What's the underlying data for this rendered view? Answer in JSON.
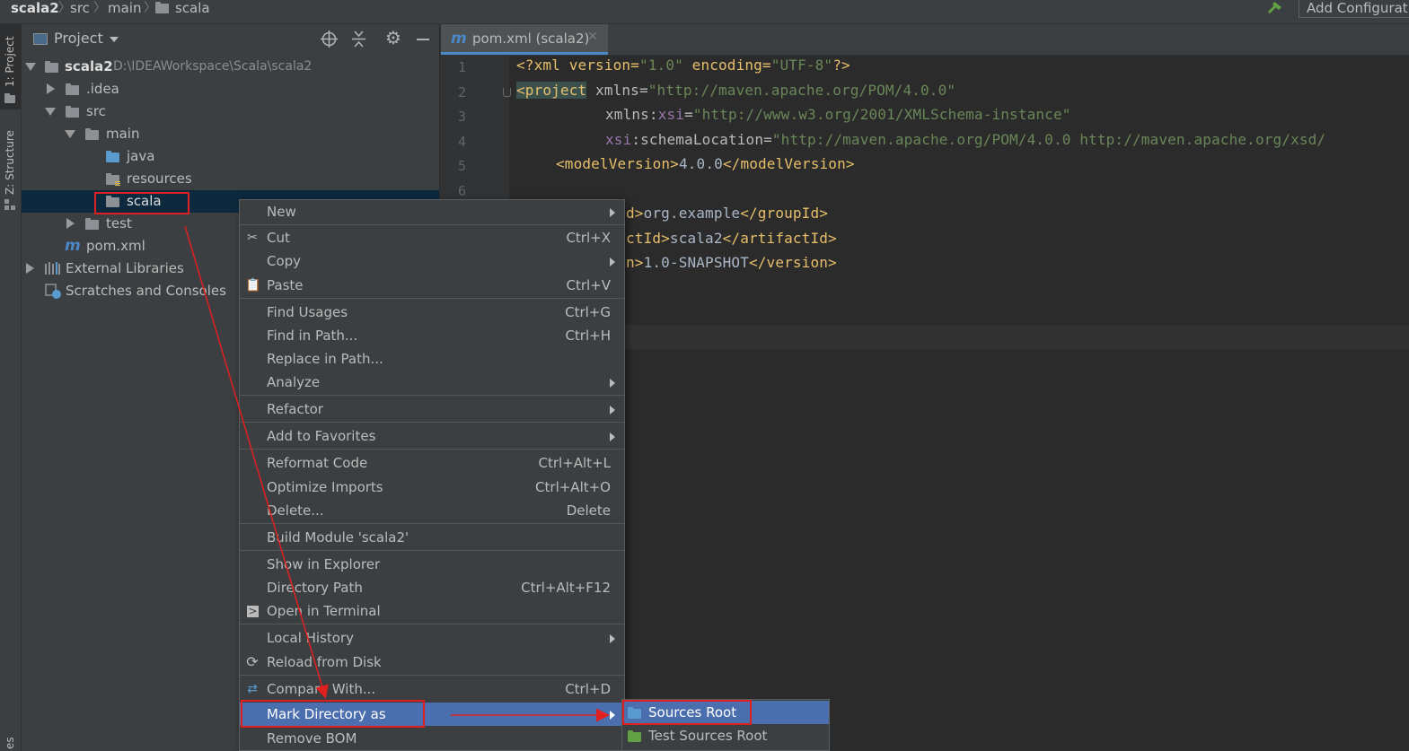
{
  "navbar": {
    "crumbs": [
      "scala2",
      "src",
      "main",
      "scala"
    ],
    "run_config_label": "Add Configurat"
  },
  "leftstrip": {
    "project_tool": "1: Project",
    "structure_tool": "Z: Structure",
    "bottom_tool": "es"
  },
  "project_panel": {
    "title": "Project",
    "tree": [
      {
        "label": "scala2",
        "path": "D:\\IDEAWorkspace\\Scala\\scala2"
      },
      {
        "label": ".idea"
      },
      {
        "label": "src"
      },
      {
        "label": "main"
      },
      {
        "label": "java"
      },
      {
        "label": "resources"
      },
      {
        "label": "scala"
      },
      {
        "label": "test"
      },
      {
        "label": "pom.xml"
      },
      {
        "label": "External Libraries"
      },
      {
        "label": "Scratches and Consoles"
      }
    ]
  },
  "editor": {
    "tab_label": "pom.xml (scala2)",
    "line_numbers": [
      "1",
      "2",
      "3",
      "4",
      "5",
      "6"
    ],
    "lines": {
      "l1_a": "<?xml version=",
      "l1_b": "\"1.0\"",
      "l1_c": " encoding=",
      "l1_d": "\"UTF-8\"",
      "l1_e": "?>",
      "l2_tag": "<project",
      "l2_attr": " xmlns=",
      "l2_val": "\"http://maven.apache.org/POM/4.0.0\"",
      "l3_attr": "xmlns:",
      "l3_ns": "xsi",
      "l3_eq": "=",
      "l3_val": "\"http://www.w3.org/2001/XMLSchema-instance\"",
      "l4_ns": "xsi",
      "l4_attr": ":schemaLocation=",
      "l4_val": "\"http://maven.apache.org/POM/4.0.0 http://maven.apache.org/xsd/",
      "l5_open": "<modelVersion>",
      "l5_txt": "4.0.0",
      "l5_close": "</modelVersion>",
      "l7_open": "d>",
      "l7_txt": "org.example",
      "l7_close": "</groupId>",
      "l8_open": "ctId>",
      "l8_txt": "scala2",
      "l8_close": "</artifactId>",
      "l9_open": "n>",
      "l9_txt": "1.0-SNAPSHOT",
      "l9_close": "</version>"
    }
  },
  "context_menu": {
    "items": [
      {
        "label": "New",
        "shortcut": ""
      },
      {
        "label": "Cut",
        "shortcut": "Ctrl+X"
      },
      {
        "label": "Copy",
        "shortcut": ""
      },
      {
        "label": "Paste",
        "shortcut": "Ctrl+V"
      },
      {
        "label": "Find Usages",
        "shortcut": "Ctrl+G"
      },
      {
        "label": "Find in Path...",
        "shortcut": "Ctrl+H"
      },
      {
        "label": "Replace in Path...",
        "shortcut": ""
      },
      {
        "label": "Analyze",
        "shortcut": ""
      },
      {
        "label": "Refactor",
        "shortcut": ""
      },
      {
        "label": "Add to Favorites",
        "shortcut": ""
      },
      {
        "label": "Reformat Code",
        "shortcut": "Ctrl+Alt+L"
      },
      {
        "label": "Optimize Imports",
        "shortcut": "Ctrl+Alt+O"
      },
      {
        "label": "Delete...",
        "shortcut": "Delete"
      },
      {
        "label": "Build Module 'scala2'",
        "shortcut": ""
      },
      {
        "label": "Show in Explorer",
        "shortcut": ""
      },
      {
        "label": "Directory Path",
        "shortcut": "Ctrl+Alt+F12"
      },
      {
        "label": "Open in Terminal",
        "shortcut": ""
      },
      {
        "label": "Local History",
        "shortcut": ""
      },
      {
        "label": "Reload from Disk",
        "shortcut": ""
      },
      {
        "label": "Compare With...",
        "shortcut": "Ctrl+D"
      },
      {
        "label": "Mark Directory as",
        "shortcut": ""
      },
      {
        "label": "Remove BOM",
        "shortcut": ""
      }
    ]
  },
  "submenu": {
    "items": [
      {
        "label": "Sources Root"
      },
      {
        "label": "Test Sources Root"
      }
    ]
  },
  "colors": {
    "selection": "#4b6eaf",
    "annotation_red": "#e02020",
    "tab_underline": "#4a88c7"
  }
}
